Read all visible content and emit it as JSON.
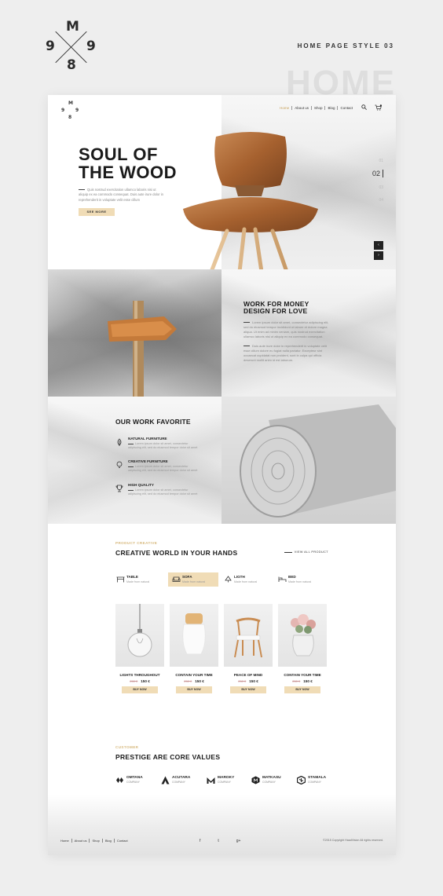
{
  "presentation": {
    "logo": {
      "top": "M",
      "left": "9",
      "right": "9",
      "bottom": "8"
    },
    "style_label": "HOME PAGE STYLE 03",
    "ghost_text": "HOME"
  },
  "header": {
    "nav": [
      "Home",
      "About us",
      "Shop",
      "Blog",
      "Contact"
    ],
    "active_nav": "Home",
    "cart_count": "0"
  },
  "hero": {
    "title_line1": "SOUL OF",
    "title_line2": "THE WOOD",
    "text": "Quis nostrud exercitation ullamco laboris nisi ut aliquip ex ea commodo consequat. Duis aute irure dolor in reprehenderit in voluptate velit esse cillum",
    "button": "SEE MORE",
    "pager": [
      "01",
      "02",
      "03",
      "04"
    ],
    "current_page": "02",
    "arrow_prev": "‹",
    "arrow_next": "›"
  },
  "work": {
    "title_line1": "WORK FOR MONEY",
    "title_line2": "DESIGN FOR LOVE",
    "p1": "Lorem ipsum dolor sit amet, consectetur adipiscing elit, sed do eiusmod tempor incididunt ut labore et dolore magna aliqua. Ut enim ad minim veniam, quis nostrud exercitation ullamco laboris nisi ut aliquip ex ea commodo consequat.",
    "p2": "Duis aute irure dolor in reprehenderit in voluptate velit esse cillum dolore eu fugiat nulla pariatur. Excepteur sint occaecat cupidatat non proident, sunt in culpa qui officia deserunt mollit anim id est laborum."
  },
  "favorites": {
    "title": "OUR WORK FAVORITE",
    "items": [
      {
        "title": "NATURAL FURNITURE",
        "text": "Lorem ipsum dolor sit amet, consectetur adipiscing elit, sed do eiusmod tempor dolor sit amet"
      },
      {
        "title": "CREATIVE FURNITURE",
        "text": "Lorem ipsum dolor sit amet, consectetur adipiscing elit, sed do eiusmod tempor dolor sit amet"
      },
      {
        "title": "HIGH QUALITY",
        "text": "Lorem ipsum dolor sit amet, consectetur adipiscing elit, sed do eiusmod tempor dolor sit amet"
      }
    ]
  },
  "products": {
    "eyebrow": "PRODUCT CREATIVE",
    "title": "CREATIVE WORLD IN YOUR HANDS",
    "view_all": "VIEW ALL PRODUCT",
    "categories": [
      {
        "name": "TABLE",
        "sub": "Made from natural"
      },
      {
        "name": "SOFA",
        "sub": "Made from natural"
      },
      {
        "name": "LIGTH",
        "sub": "Made from natural"
      },
      {
        "name": "BED",
        "sub": "Made from natural"
      }
    ],
    "active_category": "SOFA",
    "items": [
      {
        "name": "LIGHTS THROUGHOUT",
        "old_price": "250 €",
        "price": "150 €",
        "button": "BUY NOW"
      },
      {
        "name": "CONTAIN YOUR TIME",
        "old_price": "250 €",
        "price": "150 €",
        "button": "BUY NOW"
      },
      {
        "name": "PEACE OF MIND",
        "old_price": "250 €",
        "price": "150 €",
        "button": "BUY NOW"
      },
      {
        "name": "CONTAIN YOUR TIME",
        "old_price": "250 €",
        "price": "150 €",
        "button": "BUY NOW"
      }
    ]
  },
  "clients": {
    "eyebrow": "CUSTOMER",
    "title": "PRESTIGE ARE CORE VALUES",
    "brands": [
      {
        "name": "OMTANA",
        "sub": "COMPANY"
      },
      {
        "name": "ACUTARA",
        "sub": "COMPANY"
      },
      {
        "name": "MAROKY",
        "sub": "COMPANY"
      },
      {
        "name": "MATKASU",
        "sub": "COMPANY"
      },
      {
        "name": "STAMALA",
        "sub": "COMPANY"
      }
    ]
  },
  "footer": {
    "nav": [
      "Home",
      "About us",
      "Shop",
      "Blog",
      "Contact"
    ],
    "social": [
      "f",
      "t",
      "g+"
    ],
    "copyright": "©2015 Copyright HaadVision All rights reserved."
  },
  "colors": {
    "accent": "#f0dcb6",
    "accent_text": "#c9a25b",
    "text": "#1a1a1a"
  }
}
